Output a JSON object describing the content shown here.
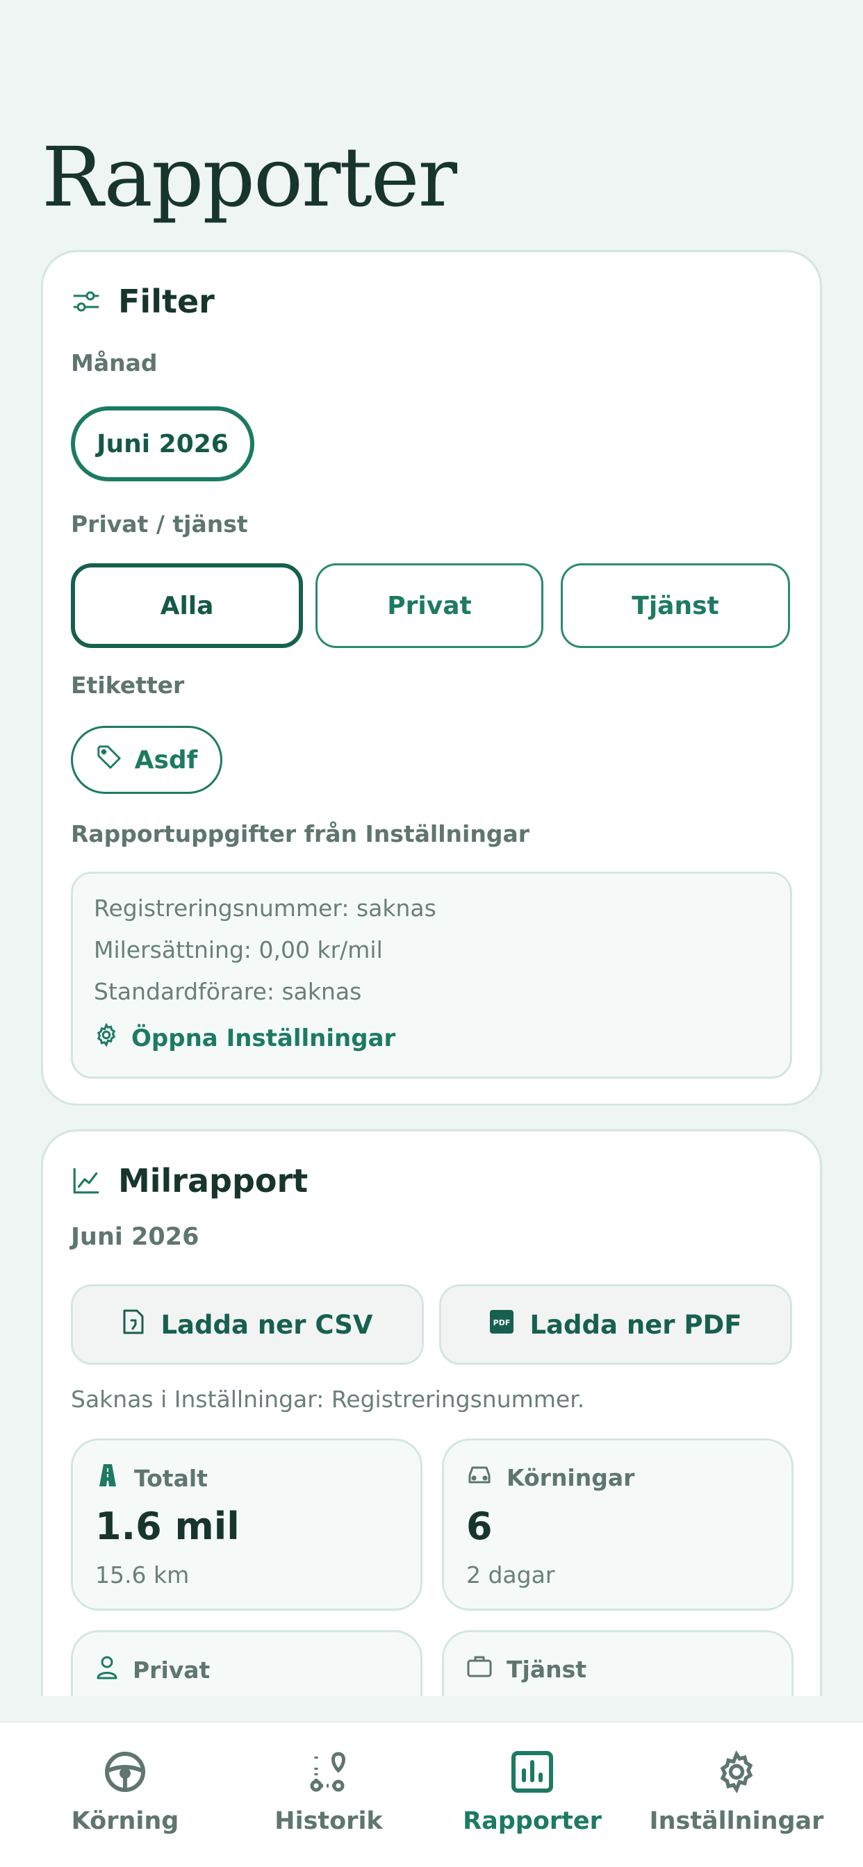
{
  "page": {
    "title": "Rapporter"
  },
  "filter": {
    "title": "Filter",
    "month_label": "Månad",
    "month_value": "Juni 2026",
    "type_label": "Privat / tjänst",
    "type_options": [
      "Alla",
      "Privat",
      "Tjänst"
    ],
    "type_selected": "Alla",
    "tags_label": "Etiketter",
    "tags": [
      "Asdf"
    ],
    "settings_label": "Rapportuppgifter från Inställningar",
    "settings_lines": [
      "Registreringsnummer: saknas",
      "Milersättning: 0,00 kr/mil",
      "Standardförare: saknas"
    ],
    "open_settings": "Öppna Inställningar"
  },
  "report": {
    "title": "Milrapport",
    "period": "Juni 2026",
    "csv_button": "Ladda ner CSV",
    "pdf_button": "Ladda ner PDF",
    "missing_note": "Saknas i Inställningar: Registreringsnummer.",
    "stats": [
      {
        "label": "Totalt",
        "value": "1.6 mil",
        "sub": "15.6 km",
        "icon": "road-icon"
      },
      {
        "label": "Körningar",
        "value": "6",
        "sub": "2 dagar",
        "icon": "car-icon"
      },
      {
        "label": "Privat",
        "value": "",
        "sub": "",
        "icon": "person-icon"
      },
      {
        "label": "Tjänst",
        "value": "",
        "sub": "",
        "icon": "briefcase-icon"
      }
    ]
  },
  "tabbar": {
    "items": [
      {
        "label": "Körning",
        "icon": "steering-wheel-icon"
      },
      {
        "label": "Historik",
        "icon": "route-icon"
      },
      {
        "label": "Rapporter",
        "icon": "bar-chart-icon"
      },
      {
        "label": "Inställningar",
        "icon": "gear-icon"
      }
    ],
    "active": "Rapporter"
  },
  "colors": {
    "accent": "#1d7a63",
    "background": "#eef5f2",
    "text": "#17352d",
    "muted": "#5f7670"
  }
}
